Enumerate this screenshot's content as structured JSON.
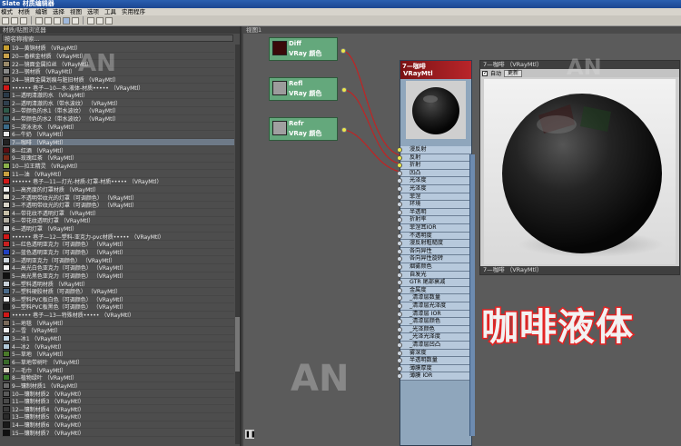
{
  "app_title": "Slate 材质编辑器",
  "menu": [
    "模式",
    "材质",
    "编辑",
    "选择",
    "视图",
    "选项",
    "工具",
    "实用程序"
  ],
  "sidebar": {
    "title": "材质/贴图浏览器",
    "search_placeholder": "按名称搜索...",
    "items": [
      {
        "label": "19—黄铜材质  （VRayMtl）",
        "color": "#c8a030"
      },
      {
        "label": "20—香槟金材质  （VRayMtl）",
        "color": "#c9a24a"
      },
      {
        "label": "22—镜面金属拉丝   （VRayMtl）",
        "color": "#9a8a6a"
      },
      {
        "label": "23—钢材质  （VRayMtl）",
        "color": "#8a8a8a"
      },
      {
        "label": "24—镜面金属划痕与脏旧材质  （VRayMtl）",
        "color": "#7a7066"
      },
      {
        "label": "•••••• 巷子—10—水-液体-材质•••••  （VRayMtl）",
        "color": "#d01818"
      },
      {
        "label": "1—透明清澈的水  （VRayMtl）",
        "color": "#2a3a48"
      },
      {
        "label": "2—透明清澈的水（带水波纹）  （VRayMtl）",
        "color": "#30404e"
      },
      {
        "label": "3—带颜色的水1（带水波纹）  （VRayMtl）",
        "color": "#2f5a4a"
      },
      {
        "label": "4—带颜色的水2（带水波纹）  （VRayMtl）",
        "color": "#355b64"
      },
      {
        "label": "5—游泳池水  （VRayMtl）",
        "color": "#3a6a88"
      },
      {
        "label": "6—牛奶  （VRayMtl）",
        "color": "#e8e8e8"
      },
      {
        "label": "7—咖啡  （VRayMtl）",
        "color": "#222222"
      },
      {
        "label": "8—红酒  （VRayMtl）",
        "color": "#5a0e12"
      },
      {
        "label": "9—玫瑰红茶  （VRayMtl）",
        "color": "#7a2a18"
      },
      {
        "label": "10—拉王精灵  （VRayMtl）",
        "color": "#8ab04a"
      },
      {
        "label": "11—油  （VRayMtl）",
        "color": "#c8a040"
      },
      {
        "label": "•••••• 巷子—11—灯光-材质-灯罩-材质•••••  （VRayMtl）",
        "color": "#d01818"
      },
      {
        "label": "1—高亮度的灯罩材质  （VRayMtl）",
        "color": "#f0f0f0"
      },
      {
        "label": "2—不透明带纹光的灯罩（可调颜色）  （VRayMtl）",
        "color": "#e0dcd0"
      },
      {
        "label": "3—不透明带纹光的灯罩（可调颜色）  （VRayMtl）",
        "color": "#d8d4c8"
      },
      {
        "label": "4—带花纹不透明灯罩  （VRayMtl）",
        "color": "#c8c0a8"
      },
      {
        "label": "5—带花纹透明灯罩  （VRayMtl）",
        "color": "#b8b4a8"
      },
      {
        "label": "6—透明灯罩  （VRayMtl）",
        "color": "#dcdcdc"
      },
      {
        "label": "•••••• 巷子—12—塑料-亚克力-pvc材质•••••  （VRayMtl）",
        "color": "#d01818"
      },
      {
        "label": "1—红色透明亚克力（可调颜色）  （VRayMtl）",
        "color": "#c82020"
      },
      {
        "label": "2—蓝色透明亚克力（可调颜色）  （VRayMtl）",
        "color": "#2040c0"
      },
      {
        "label": "3—透明亚克力（可调颜色）  （VRayMtl）",
        "color": "#d0d8e0"
      },
      {
        "label": "4—高光白色亚克力（可调颜色）  （VRayMtl）",
        "color": "#f4f4f4"
      },
      {
        "label": "5—高光黑色亚克力（可调颜色）  （VRayMtl）",
        "color": "#111111"
      },
      {
        "label": "6—塑料透明材质  （VRayMtl）",
        "color": "#c8d0d8"
      },
      {
        "label": "7—塑料硬胶材质（可调颜色）  （VRayMtl）",
        "color": "#4a6a8a"
      },
      {
        "label": "8—塑料PVC板白色（可调颜色）  （VRayMtl）",
        "color": "#eeeeee"
      },
      {
        "label": "9—塑料PVC板黑色（可调颜色）  （VRayMtl）",
        "color": "#1a1a1a"
      },
      {
        "label": "•••••• 巷子—13—特殊材质•••••  （VRayMtl）",
        "color": "#d01818"
      },
      {
        "label": "1—地毯  （VRayMtl）",
        "color": "#7a6a5a"
      },
      {
        "label": "2—雪  （VRayMtl）",
        "color": "#f0f0f0"
      },
      {
        "label": "3—冰1  （VRayMtl）",
        "color": "#c8dce8"
      },
      {
        "label": "4—冰2  （VRayMtl）",
        "color": "#b0c8d8"
      },
      {
        "label": "5—草地  （VRayMtl）",
        "color": "#4a7a2a"
      },
      {
        "label": "6—草地带树叶  （VRayMtl）",
        "color": "#3a6a2a"
      },
      {
        "label": "7—毛巾  （VRayMtl）",
        "color": "#d8d0c0"
      },
      {
        "label": "8—植物绿叶  （VRayMtl）",
        "color": "#3a7a2a"
      },
      {
        "label": "9—镶制材质1  （VRayMtl）",
        "color": "#6a6a6a"
      },
      {
        "label": "10—镶制材质2  （VRayMtl）",
        "color": "#5a5a5a"
      },
      {
        "label": "11—镶制材质3  （VRayMtl）",
        "color": "#4a4a4a"
      },
      {
        "label": "12—镶制材质4  （VRayMtl）",
        "color": "#3a3a3a"
      },
      {
        "label": "13—镶制材质5  （VRayMtl）",
        "color": "#2a2a2a"
      },
      {
        "label": "14—镶制材质6  （VRayMtl）",
        "color": "#1a1a1a"
      },
      {
        "label": "15—镶制材质7  （VRayMtl）",
        "color": "#101010"
      }
    ],
    "selected_index": 12
  },
  "graph": {
    "tab_label": "视图1",
    "nodes": [
      {
        "line1": "Diff",
        "line2": "VRay 颜色",
        "swatch": "#3a0a0a"
      },
      {
        "line1": "Refl",
        "line2": "VRay 颜色",
        "swatch": "#9c9c9c"
      },
      {
        "line1": "Refr",
        "line2": "VRay 颜色",
        "swatch": "#a0a0a0"
      }
    ],
    "vraymtl": {
      "title1": "7—咖啡",
      "title2": "VRayMtl",
      "slots": [
        "漫反射",
        "反射",
        "折射",
        "凹凸",
        "光泽度",
        "光泽度",
        "菲涅",
        "环境",
        "半透明",
        "折射率",
        "菲涅耳IOR",
        "不透明度",
        "漫反射粗糙度",
        "各向异性",
        "各向异性旋转",
        "烟雾颜色",
        "自发光",
        "GTR 尾部衰减",
        "金属度",
        "_清漆层数量",
        "_清漆层光泽度",
        "_清漆层 IOR",
        "_清漆层颜色",
        "_光泽颜色",
        "_光泽光泽度",
        "_清漆层凹凸",
        "雾深度",
        "半透明数量",
        "薄膜厚度",
        "薄膜 IOR"
      ]
    }
  },
  "preview": {
    "title": "7—咖啡  （VRayMtl）",
    "auto_label": "自动",
    "update_label": "更新",
    "footer": "7—咖啡  （VRayMtl）"
  },
  "overlay_text": "咖啡液体",
  "pause_label": "❚❚"
}
